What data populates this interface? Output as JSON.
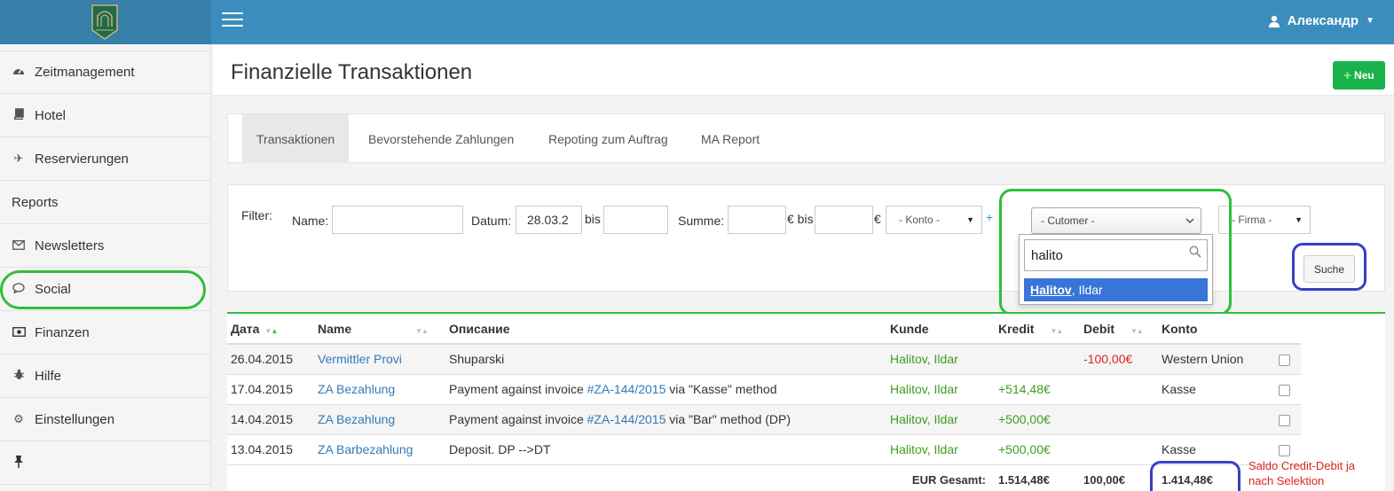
{
  "header": {
    "user_name": "Александр",
    "colors": {
      "topbar": "#3b8dbd",
      "brand": "#367fa9"
    }
  },
  "sidebar": {
    "items": [
      {
        "label": "Zeitmanagement",
        "icon": "dashboard-icon"
      },
      {
        "label": "Hotel",
        "icon": "book-icon"
      },
      {
        "label": "Reservierungen",
        "icon": "plane-icon"
      },
      {
        "label": "Reports",
        "icon": ""
      },
      {
        "label": "Newsletters",
        "icon": "envelope-icon"
      },
      {
        "label": "Social",
        "icon": "comment-icon"
      },
      {
        "label": "Finanzen",
        "icon": "money-icon"
      },
      {
        "label": "Hilfe",
        "icon": "bug-icon"
      },
      {
        "label": "Einstellungen",
        "icon": "gears-icon"
      }
    ]
  },
  "page": {
    "title": "Finanzielle Transaktionen",
    "new_button": "Neu"
  },
  "tabs": [
    "Transaktionen",
    "Bevorstehende Zahlungen",
    "Repoting zum Auftrag",
    "MA Report"
  ],
  "filter": {
    "label": "Filter:",
    "name_label": "Name:",
    "name_value": "",
    "datum_label": "Datum:",
    "datum_from": "28.03.2",
    "bis_label": "bis",
    "datum_to": "",
    "summe_label": "Summe:",
    "summe_from": "",
    "euro_bis": "€ bis",
    "summe_to": "",
    "euro": "€",
    "konto": "- Konto -",
    "plus": "+",
    "customer": "- Cutomer -",
    "firma": "- Firma -",
    "search_value": "halito",
    "option_highlight": "Halitov",
    "option_rest": ", Ildar",
    "suche": "Suche"
  },
  "table": {
    "headers": [
      "Дата",
      "Name",
      "Описание",
      "Kunde",
      "Kredit",
      "Debit",
      "Konto"
    ],
    "rows": [
      {
        "date": "26.04.2015",
        "name": "Vermittler Provi",
        "desc_pre": "Shuparski",
        "desc_link": "",
        "desc_post": "",
        "kunde": "Halitov, Ildar",
        "kredit": "",
        "debit": "-100,00€",
        "konto": "Western Union"
      },
      {
        "date": "17.04.2015",
        "name": "ZA Bezahlung",
        "desc_pre": "Payment against invoice ",
        "desc_link": "#ZA-144/2015",
        "desc_post": " via \"Kasse\" method",
        "kunde": "Halitov, Ildar",
        "kredit": "+514,48€",
        "debit": "",
        "konto": "Kasse"
      },
      {
        "date": "14.04.2015",
        "name": "ZA Bezahlung",
        "desc_pre": "Payment against invoice ",
        "desc_link": "#ZA-144/2015",
        "desc_post": " via \"Bar\" method (DP)",
        "kunde": "Halitov, Ildar",
        "kredit": "+500,00€",
        "debit": "",
        "konto": ""
      },
      {
        "date": "13.04.2015",
        "name": "ZA Barbezahlung",
        "desc_pre": "Deposit. DP -->DT",
        "desc_link": "",
        "desc_post": "",
        "kunde": "Halitov, Ildar",
        "kredit": "+500,00€",
        "debit": "",
        "konto": "Kasse"
      }
    ],
    "total_label": "EUR Gesamt:",
    "total_kredit": "1.514,48€",
    "total_debit": "100,00€",
    "total_saldo": "1.414,48€"
  },
  "annotation": "Saldo Credit-Debit ja nach Selektion"
}
